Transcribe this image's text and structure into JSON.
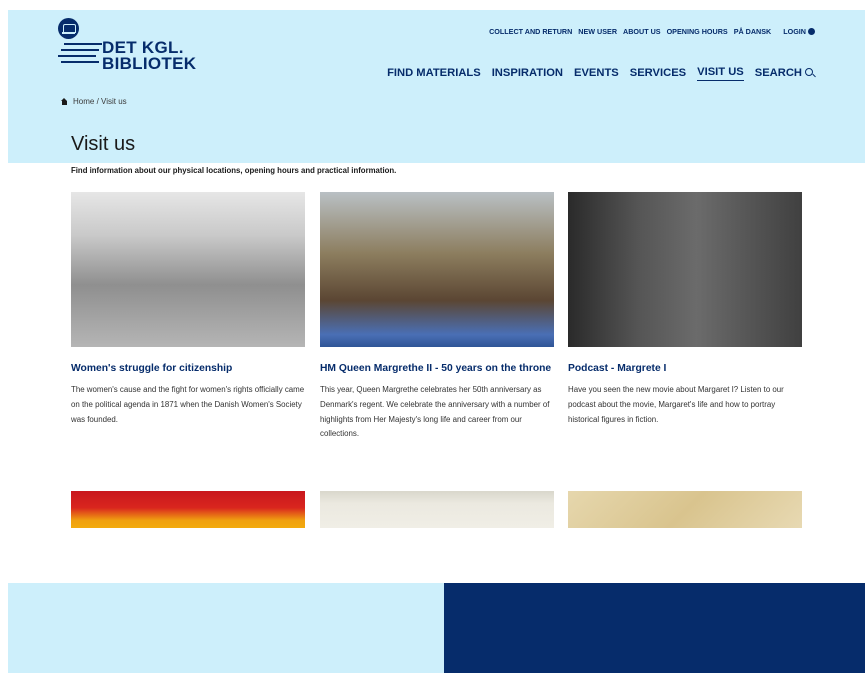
{
  "logo": {
    "line1": "DET KGL.",
    "line2": "BIBLIOTEK"
  },
  "util_nav": [
    "COLLECT AND RETURN",
    "NEW USER",
    "ABOUT US",
    "OPENING HOURS",
    "PÅ DANSK",
    "LOGIN"
  ],
  "main_nav": [
    {
      "label": "FIND MATERIALS",
      "active": false
    },
    {
      "label": "INSPIRATION",
      "active": false
    },
    {
      "label": "EVENTS",
      "active": false
    },
    {
      "label": "SERVICES",
      "active": false
    },
    {
      "label": "VISIT US",
      "active": true
    },
    {
      "label": "SEARCH",
      "active": false
    }
  ],
  "breadcrumb": "Home / Visit us",
  "page": {
    "title": "Visit us",
    "intro": "Find information about our physical locations, opening hours and practical information."
  },
  "cards": [
    {
      "title": "Women's struggle for citizenship",
      "desc": "The women's cause and the fight for women's rights officially came on the political agenda in 1871 when the Danish Women's Society was founded."
    },
    {
      "title": "HM Queen Margrethe II - 50 years on the throne",
      "desc": "This year, Queen Margrethe celebrates her 50th anniversary as Denmark's regent. We celebrate the anniversary with a number of highlights from Her Majesty's long life and career from our collections."
    },
    {
      "title": "Podcast - Margrete I",
      "desc": "Have you seen the new movie about Margaret I? Listen to our podcast about the movie, Margaret's life and how to portray historical figures in fiction."
    }
  ],
  "colors": {
    "brand": "#062c6b",
    "band": "#cdeffb"
  },
  "icons": [
    "crown-logo-icon",
    "login-user-icon",
    "search-icon",
    "home-icon"
  ]
}
